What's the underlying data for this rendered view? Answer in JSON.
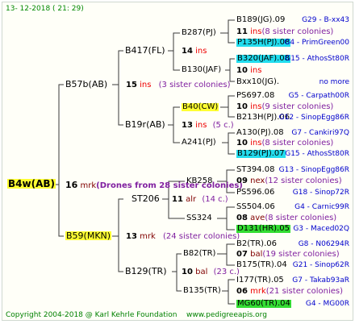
{
  "header": {
    "timestamp": "13- 12-2018 ( 21: 29)"
  },
  "root": {
    "label": "B4w(AB)",
    "num": "16",
    "tag": "mrk",
    "drones": "(Drones from 28 sister colonies)"
  },
  "gen1": [
    {
      "label": "B57b(AB)",
      "num": "15",
      "tag": "ins",
      "sisters": "(3 sister colonies)"
    },
    {
      "label": "B59(MKN)",
      "num": "13",
      "tag": "mrk",
      "sisters": "(24 sister colonies)"
    }
  ],
  "gen2": [
    {
      "label": "B417(FL)"
    },
    {
      "label": "B19r(AB)",
      "num": "13",
      "tag": "ins",
      "sisters": "(5 c.)"
    },
    {
      "label": "ST206",
      "num": "11",
      "tag": "alr",
      "sisters": "(14 c.)"
    },
    {
      "label": "B129(TR)",
      "num": "10",
      "tag": "bal",
      "sisters": "(23 c.)"
    }
  ],
  "gen3": [
    {
      "label": "B287(PJ)",
      "num": "14",
      "tag": "ins"
    },
    {
      "label": "B130(JAF)"
    },
    {
      "label": "B40(CW)"
    },
    {
      "label": "A241(PJ)",
      "num": "10",
      "tag": "ins"
    },
    {
      "label": "KB258"
    },
    {
      "label": "SS324"
    },
    {
      "label": "B82(TR)"
    },
    {
      "label": "B135(TR)"
    }
  ],
  "gen4": [
    {
      "label": "B189(JG).09",
      "code": "G29 - B-xx43"
    },
    {
      "num": "11",
      "tag": "ins",
      "sisters": "(8 sister colonies)"
    },
    {
      "label": "P135H(PJ).08",
      "code": "G4 - PrimGreen00"
    },
    {
      "label": "B320(JAF).08",
      "code": "G15 - AthosSt80R"
    },
    {
      "num": "10",
      "tag": "ins"
    },
    {
      "label": "Bxx10(JG).",
      "code": "no more"
    },
    {
      "label": "PS697.08",
      "code": "G5 - Carpath00R"
    },
    {
      "num": "10",
      "tag": "ins",
      "sisters": "(9 sister colonies)"
    },
    {
      "label": "B213H(PJ).06",
      "code": "G12 - SinopEgg86R"
    },
    {
      "label": "A130(PJ).08",
      "code": "G7 - Cankiri97Q"
    },
    {
      "num": "10",
      "tag": "ins",
      "sisters": "(8 sister colonies)"
    },
    {
      "label": "B129(PJ).07",
      "code": "G15 - AthosSt80R"
    },
    {
      "label": "ST394.08",
      "code": "G13 - SinopEgg86R"
    },
    {
      "num": "09",
      "tag": "nex",
      "sisters": "(12 sister colonies)"
    },
    {
      "label": "PS596.06",
      "code": "G18 - Sinop72R"
    },
    {
      "label": "SS504.06",
      "code": "G4 - Carnic99R"
    },
    {
      "num": "08",
      "tag": "ave",
      "sisters": "(8 sister colonies)"
    },
    {
      "label": "D131(HR).05",
      "code": "G3 - Maced02Q"
    },
    {
      "label": "B2(TR).06",
      "code": "G8 - N06294R"
    },
    {
      "num": "07",
      "tag": "bal",
      "sisters": "(19 sister colonies)"
    },
    {
      "label": "B175(TR).04",
      "code": "G21 - Sinop62R"
    },
    {
      "label": "I177(TR).05",
      "code": "G7 - Takab93aR"
    },
    {
      "num": "06",
      "tag": "mrk",
      "sisters": "(21 sister colonies)"
    },
    {
      "label": "MG60(TR).04",
      "code": "G4 - MG00R"
    }
  ],
  "footer": {
    "copyright": "Copyright 2004-2018 @ Karl Kehrle Foundation",
    "url": "www.pedigreeapis.org"
  }
}
